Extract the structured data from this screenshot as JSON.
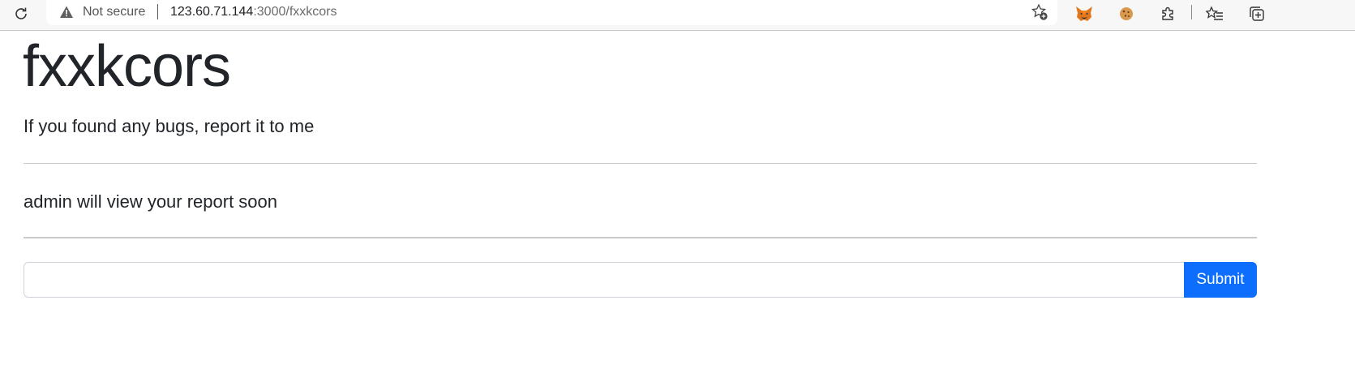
{
  "browser": {
    "security_label": "Not secure",
    "url_host": "123.60.71.144",
    "url_rest": ":3000/fxxkcors",
    "icons": [
      "reload-icon",
      "warning-icon",
      "favorite-add-icon",
      "metamask-fox-icon",
      "cookie-icon",
      "extensions-icon",
      "favorites-icon",
      "collections-icon"
    ]
  },
  "page": {
    "title": "fxxkcors",
    "lead": "If you found any bugs, report it to me",
    "notice": "admin will view your report soon",
    "report_input_value": "",
    "submit_label": "Submit",
    "accent_color": "#0d6efd"
  }
}
